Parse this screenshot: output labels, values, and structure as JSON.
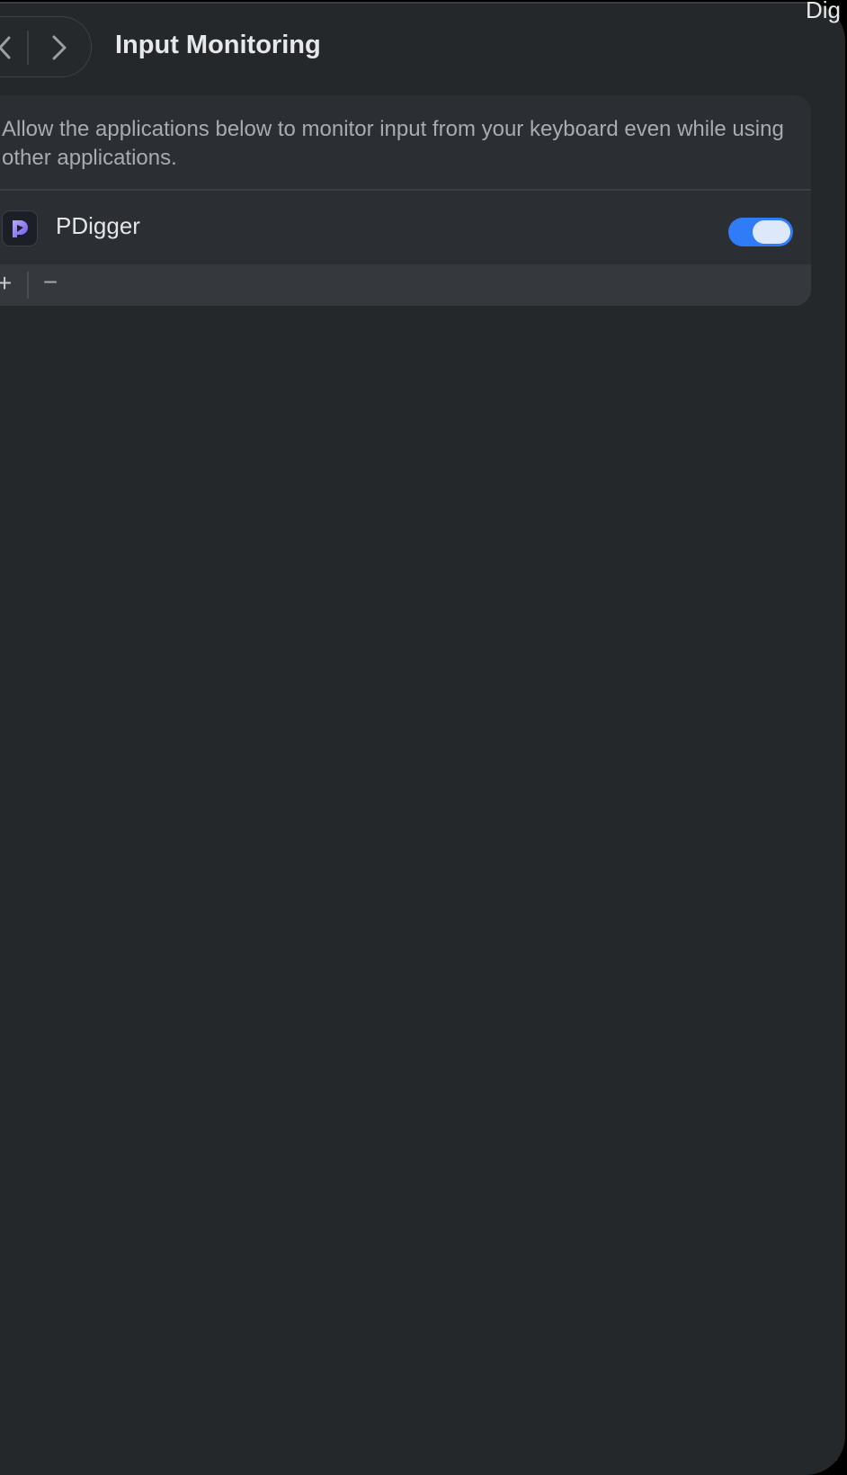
{
  "header": {
    "title": "Input Monitoring",
    "back_icon": "chevron-left-icon",
    "forward_icon": "chevron-right-icon"
  },
  "panel": {
    "description": "Allow the applications below to monitor input from your keyboard even while using other applications.",
    "apps": [
      {
        "name": "PDigger",
        "icon": "pdigger-app-icon",
        "enabled": true
      }
    ],
    "footer": {
      "add_label": "+",
      "remove_label": "−"
    }
  },
  "background_window": {
    "title_fragment": "Dig"
  },
  "colors": {
    "window_bg": "#25282b",
    "panel_bg": "#2b2e32",
    "toggle_on": "#2f7cf6",
    "text_primary": "#e7e8ea",
    "text_secondary": "#a8abaf"
  }
}
